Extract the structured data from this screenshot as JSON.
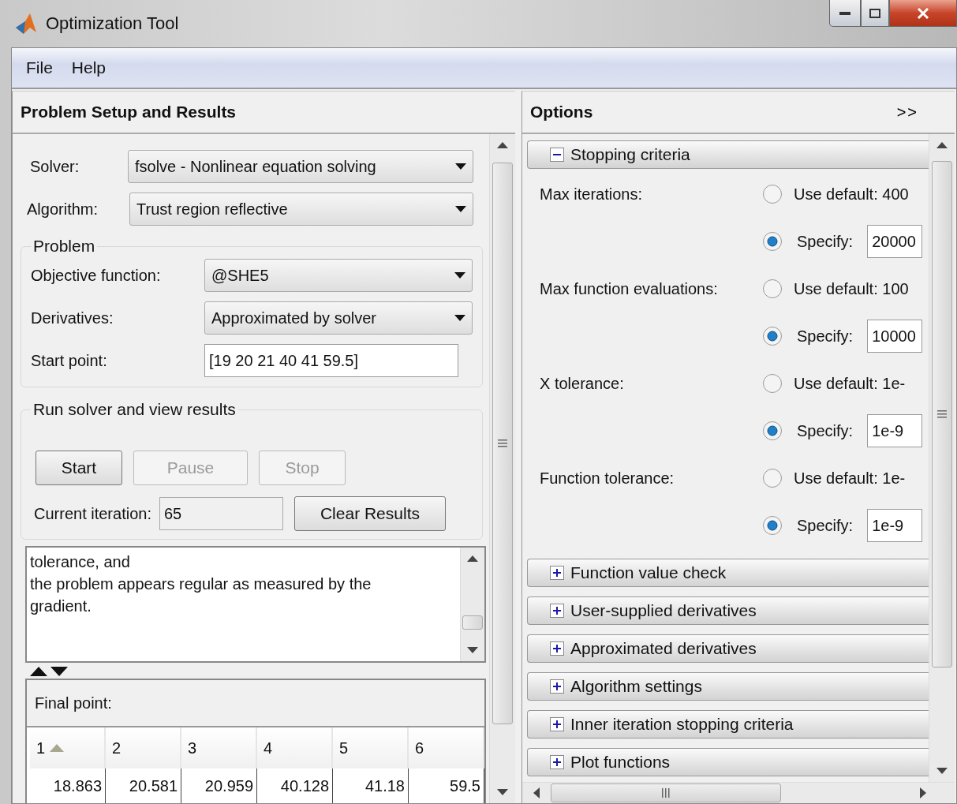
{
  "window": {
    "title": "Optimization Tool"
  },
  "menu": [
    {
      "label": "File"
    },
    {
      "label": "Help"
    }
  ],
  "problem_panel": {
    "title": "Problem Setup and Results",
    "solver": {
      "label": "Solver:",
      "value": "fsolve - Nonlinear equation solving"
    },
    "algorithm": {
      "label": "Algorithm:",
      "value": "Trust region reflective"
    },
    "problem": {
      "legend": "Problem",
      "fields": [
        {
          "label": "Objective function:",
          "value": "@SHE5",
          "kind": "dropdown"
        },
        {
          "label": "Derivatives:",
          "value": "Approximated by solver",
          "kind": "dropdown"
        },
        {
          "label": "Start point:",
          "value": "[19 20 21 40 41 59.5]",
          "kind": "text"
        }
      ]
    },
    "run": {
      "legend": "Run solver and view results",
      "buttons": [
        {
          "label": "Start",
          "disabled": false
        },
        {
          "label": "Pause",
          "disabled": true
        },
        {
          "label": "Stop",
          "disabled": true
        }
      ],
      "iteration": {
        "label": "Current iteration:",
        "value": "65"
      },
      "clear_button": "Clear Results",
      "log": [
        "tolerance, and",
        "the problem appears regular as measured by the",
        "gradient."
      ],
      "final_point": {
        "label": "Final point:",
        "columns": [
          {
            "label": "1",
            "sorted": true
          },
          {
            "label": "2",
            "sorted": false
          },
          {
            "label": "3",
            "sorted": false
          },
          {
            "label": "4",
            "sorted": false
          },
          {
            "label": "5",
            "sorted": false
          },
          {
            "label": "6",
            "sorted": false
          }
        ],
        "values": [
          "18.863",
          "20.581",
          "20.959",
          "40.128",
          "41.18",
          "59.5"
        ]
      }
    }
  },
  "options_panel": {
    "title": "Options",
    "expand_button": ">>",
    "sections": [
      {
        "title": "Stopping criteria",
        "expanded": true,
        "criteria": [
          {
            "label": "Max iterations:",
            "options": [
              {
                "label": "Use default: 400",
                "selected": false
              },
              {
                "label": "Specify:",
                "selected": true,
                "value": "20000"
              }
            ]
          },
          {
            "label": "Max function evaluations:",
            "options": [
              {
                "label": "Use default: 100",
                "selected": false
              },
              {
                "label": "Specify:",
                "selected": true,
                "value": "10000"
              }
            ]
          },
          {
            "label": "X tolerance:",
            "options": [
              {
                "label": "Use default: 1e-",
                "selected": false
              },
              {
                "label": "Specify:",
                "selected": true,
                "value": "1e-9"
              }
            ]
          },
          {
            "label": "Function tolerance:",
            "options": [
              {
                "label": "Use default: 1e-",
                "selected": false
              },
              {
                "label": "Specify:",
                "selected": true,
                "value": "1e-9"
              }
            ]
          }
        ]
      },
      {
        "title": "Function value check",
        "expanded": false
      },
      {
        "title": "User-supplied derivatives",
        "expanded": false
      },
      {
        "title": "Approximated derivatives",
        "expanded": false
      },
      {
        "title": "Algorithm settings",
        "expanded": false
      },
      {
        "title": "Inner iteration stopping criteria",
        "expanded": false
      },
      {
        "title": "Plot functions",
        "expanded": false
      }
    ]
  }
}
